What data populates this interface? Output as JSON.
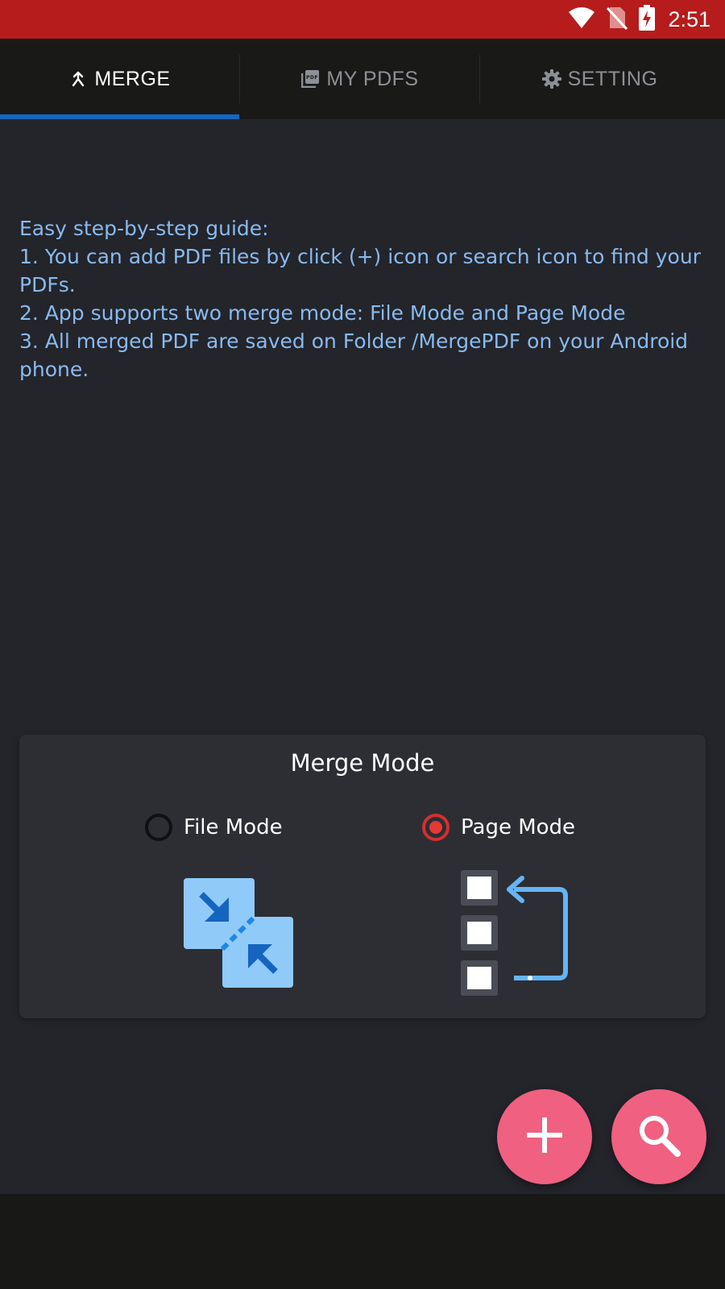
{
  "status_bar": {
    "time": "2:51",
    "icons": [
      "wifi-icon",
      "no-sim-icon",
      "battery-charging-icon"
    ],
    "background": "#b71c1c"
  },
  "tabs": [
    {
      "label": "MERGE",
      "icon": "merge-icon",
      "active": true
    },
    {
      "label": "MY PDFS",
      "icon": "pdf-icon",
      "active": false
    },
    {
      "label": "SETTING",
      "icon": "gear-icon",
      "active": false
    }
  ],
  "guide": {
    "heading": "Easy step-by-step guide:",
    "step1": "1. You can add PDF files by click (+) icon or search icon to find your PDFs.",
    "step2": "2. App supports two merge mode: File Mode and Page Mode",
    "step3": "3. All merged PDF are saved on Folder /MergePDF on your Android phone."
  },
  "merge_mode": {
    "title": "Merge Mode",
    "options": [
      {
        "label": "File Mode",
        "selected": false,
        "image": "file-merge-icon"
      },
      {
        "label": "Page Mode",
        "selected": true,
        "image": "page-order-icon"
      }
    ]
  },
  "fabs": [
    {
      "name": "add-pdf-button",
      "icon": "plus-icon"
    },
    {
      "name": "search-pdf-button",
      "icon": "search-icon"
    }
  ],
  "colors": {
    "accent": "#1565c0",
    "fab": "#f06081",
    "guide_text": "#8ab9ee",
    "radio_selected": "#e53935"
  }
}
